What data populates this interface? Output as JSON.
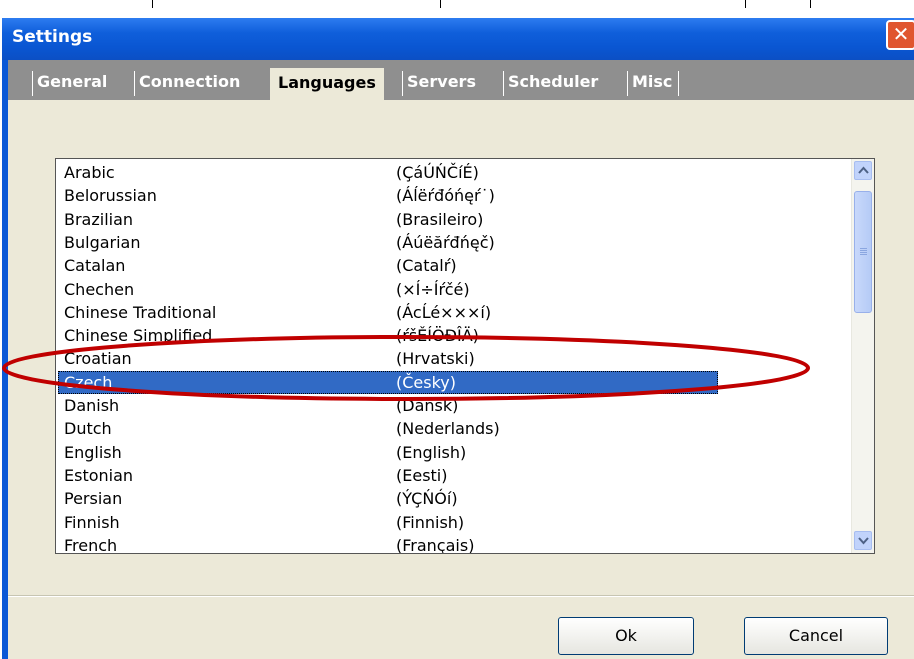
{
  "window": {
    "title": "Settings",
    "close_glyph": "✕"
  },
  "tabs": [
    {
      "label": "General"
    },
    {
      "label": "Connection"
    },
    {
      "label": "Languages"
    },
    {
      "label": "Servers"
    },
    {
      "label": "Scheduler"
    },
    {
      "label": "Misc"
    }
  ],
  "active_tab": "Languages",
  "languages": [
    {
      "name": "Arabic",
      "native": "(ÇáÚŃČíÉ)"
    },
    {
      "name": "Belorussian",
      "native": "(Áĺëŕđóńęŕ˙)"
    },
    {
      "name": "Brazilian",
      "native": "(Brasileiro)"
    },
    {
      "name": "Bulgarian",
      "native": "(Áúëăŕđńęč)"
    },
    {
      "name": "Catalan",
      "native": "(Catalŕ)"
    },
    {
      "name": "Chechen",
      "native": "(×Í÷Íŕčé)"
    },
    {
      "name": "Chinese Traditional",
      "native": "(ÁcĹé×××í)"
    },
    {
      "name": "Chinese Simplified",
      "native": "(ŕšĚÍÖĐÎÄ)"
    },
    {
      "name": "Croatian",
      "native": "(Hrvatski)"
    },
    {
      "name": "Czech",
      "native": "(Česky)",
      "selected": true
    },
    {
      "name": "Danish",
      "native": "(Dansk)"
    },
    {
      "name": "Dutch",
      "native": "(Nederlands)"
    },
    {
      "name": "English",
      "native": "(English)"
    },
    {
      "name": "Estonian",
      "native": "(Eesti)"
    },
    {
      "name": "Persian",
      "native": "(ÝÇŃÓí)"
    },
    {
      "name": "Finnish",
      "native": "(Finnish)"
    },
    {
      "name": "French",
      "native": "(Français)"
    }
  ],
  "buttons": {
    "ok": "Ok",
    "cancel": "Cancel"
  },
  "colors": {
    "titlebar": "#0a56d2",
    "selection": "#316ac5",
    "annotation_ellipse": "#c00000"
  },
  "icons": {
    "scroll_up": "chevron-up-icon",
    "scroll_down": "chevron-down-icon",
    "close": "close-icon"
  }
}
